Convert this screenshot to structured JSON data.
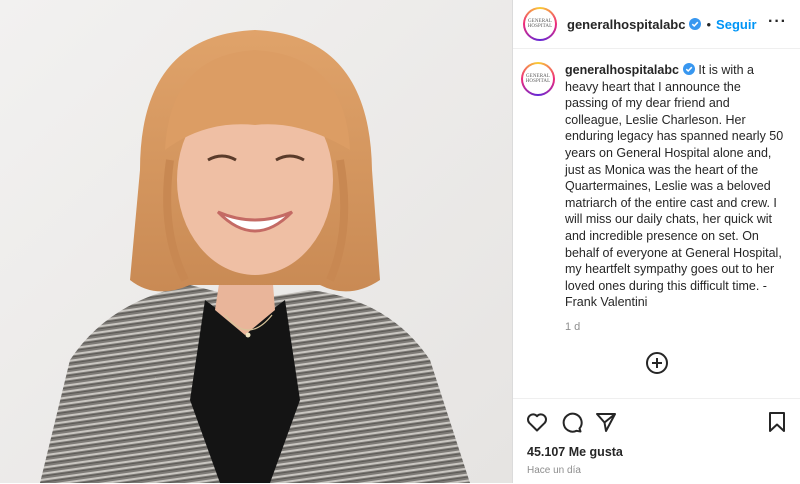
{
  "account": {
    "username": "generalhospitalabc",
    "follow_label": "Seguir",
    "separator": "•",
    "more_label": "···",
    "logo_line1": "GENERAL",
    "logo_line2": "HOSPITAL"
  },
  "caption": {
    "username": "generalhospitalabc",
    "text": "It is with a heavy heart that I announce the passing of my dear friend and colleague, Leslie Charleson. Her enduring legacy has spanned nearly 50 years on General Hospital alone and, just as Monica was the heart of the Quartermaines, Leslie was a beloved matriarch of the entire cast and crew. I will miss our daily chats, her quick wit and incredible presence on set. On behalf of everyone at General Hospital, my heartfelt sympathy goes out to her loved ones during this difficult time. - Frank Valentini",
    "age": "1 d"
  },
  "stats": {
    "likes": "45.107 Me gusta",
    "posted": "Hace un día"
  },
  "icons": {
    "like": "heart-icon",
    "comment": "comment-icon",
    "share": "send-icon",
    "save": "bookmark-icon",
    "load_more": "plus-circle-icon",
    "verified": "verified-badge-icon"
  },
  "colors": {
    "link_blue": "#0095f6",
    "verified_blue": "#3897f0",
    "muted_text": "#8e8e8e",
    "text": "#262626"
  }
}
